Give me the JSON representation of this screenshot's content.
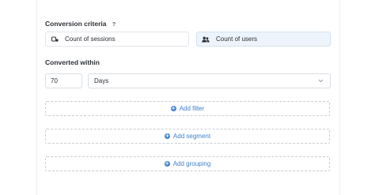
{
  "conversion_criteria": {
    "title": "Conversion criteria",
    "help": "?",
    "options": [
      {
        "label": "Count of sessions",
        "icon": "sessions-icon",
        "selected": false
      },
      {
        "label": "Count of users",
        "icon": "users-icon",
        "selected": true
      }
    ]
  },
  "converted_within": {
    "title": "Converted within",
    "value": "70",
    "unit": "Days"
  },
  "actions": {
    "add_filter": "Add filter",
    "add_segment": "Add segment",
    "add_grouping": "Add grouping"
  },
  "colors": {
    "accent": "#3d7fcf",
    "selected_bg": "#eef4fb"
  }
}
